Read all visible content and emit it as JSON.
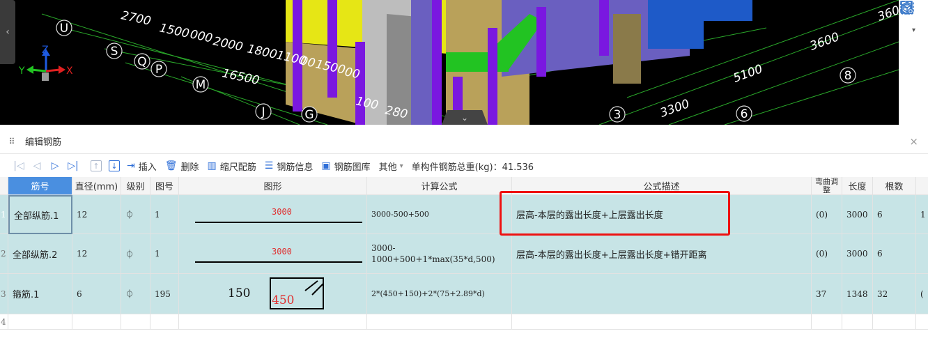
{
  "viewport": {
    "grid_labels": [
      "2700",
      "1500",
      "000",
      "2000",
      "1800",
      "1100",
      "00",
      "1500",
      "00",
      "100",
      "280",
      "16500",
      "3600",
      "5100",
      "3300",
      "360"
    ],
    "axis_bubbles": [
      "U",
      "S",
      "Q",
      "P",
      "M",
      "J",
      "G",
      "3",
      "6",
      "8"
    ],
    "axis_x": "X",
    "axis_y": "Y",
    "axis_z": "Z",
    "left_handle": "‹",
    "collapse_handle": "⌄",
    "tool_icons": [
      "cube-icon",
      "dropdown-icon",
      "fullscreen-icon",
      "view-icon",
      "report-view-icon"
    ]
  },
  "panel": {
    "title": "编辑钢筋",
    "close": "×"
  },
  "toolbar": {
    "nav": [
      "|◁",
      "◁",
      "▷",
      "▷|"
    ],
    "up": "↑",
    "down": "↓",
    "insert": "插入",
    "delete": "删除",
    "scale": "缩尺配筋",
    "info": "钢筋信息",
    "library": "钢筋图库",
    "other": "其他",
    "other_caret": "▾",
    "total_weight": "单构件钢筋总重(kg)：41.536"
  },
  "table": {
    "columns": [
      "筋号",
      "直径(mm)",
      "级别",
      "图号",
      "图形",
      "计算公式",
      "公式描述",
      "弯曲调整",
      "长度",
      "根数"
    ],
    "rows": [
      {
        "idx": "1",
        "name": "全部纵筋.1",
        "dia": "12",
        "grade": "⏀",
        "fig": "1",
        "shape_val": "3000",
        "formula": "3000-500+500",
        "desc": "层高-本层的露出长度+上层露出长度",
        "bend": "(0)",
        "len": "3000",
        "cnt": "6",
        "more": "1"
      },
      {
        "idx": "2",
        "name": "全部纵筋.2",
        "dia": "12",
        "grade": "⏀",
        "fig": "1",
        "shape_val": "3000",
        "formula": "3000-1000+500+1*max(35*d,500)",
        "desc": "层高-本层的露出长度+上层露出长度+错开距离",
        "bend": "(0)",
        "len": "3000",
        "cnt": "6",
        "more": ""
      },
      {
        "idx": "3",
        "name": "箍筋.1",
        "dia": "6",
        "grade": "⏀",
        "fig": "195",
        "shape_val_a": "150",
        "shape_val_b": "450",
        "formula": "2*(450+150)+2*(75+2.89*d)",
        "desc": "",
        "bend": "37",
        "len": "1348",
        "cnt": "32",
        "more": "("
      },
      {
        "idx": "4"
      }
    ]
  }
}
